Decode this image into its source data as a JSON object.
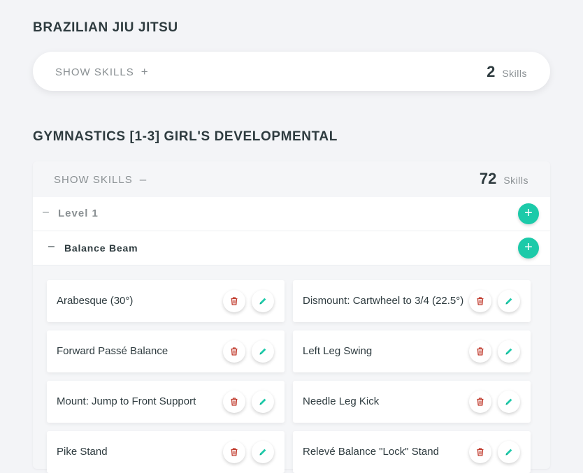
{
  "sections": [
    {
      "title": "BRAZILIAN JIU JITSU",
      "show_label": "SHOW SKILLS",
      "toggle": "+",
      "count": "2",
      "count_label": "Skills"
    },
    {
      "title": "GYMNASTICS [1-3] GIRL'S DEVELOPMENTAL",
      "show_label": "SHOW SKILLS",
      "toggle": "–",
      "count": "72",
      "count_label": "Skills"
    }
  ],
  "level": {
    "toggle": "–",
    "label": "Level 1",
    "add": "+"
  },
  "group": {
    "toggle": "–",
    "label": "Balance Beam",
    "add": "+"
  },
  "skills": [
    "Arabesque (30°)",
    "Dismount: Cartwheel to 3/4 (22.5°)",
    "Forward Passé Balance",
    "Left Leg Swing",
    "Mount: Jump to Front Support",
    "Needle Leg Kick",
    "Pike Stand",
    "Relevé Balance \"Lock\" Stand"
  ],
  "icons": {
    "delete": "trash-icon",
    "edit": "pencil-icon"
  },
  "colors": {
    "accent": "#1ccaa9",
    "delete": "#c0392b",
    "background": "#f3f4f7"
  }
}
